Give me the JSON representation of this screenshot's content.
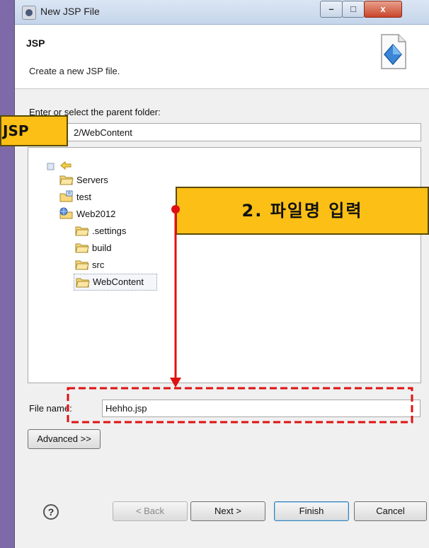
{
  "window": {
    "title": "New JSP File",
    "controls": {
      "minimize": "–",
      "maximize": "□",
      "close": "x"
    }
  },
  "header": {
    "title": "JSP",
    "description": "Create a new JSP file."
  },
  "folder": {
    "label": "Enter or select the parent folder:",
    "value": "2/WebContent"
  },
  "tree": {
    "items": [
      {
        "label": "Servers",
        "icon": "folder-icon"
      },
      {
        "label": "test",
        "icon": "project-icon"
      },
      {
        "label": "Web2012",
        "icon": "web-project-icon"
      },
      {
        "label": ".settings",
        "icon": "folder-icon"
      },
      {
        "label": "build",
        "icon": "folder-icon"
      },
      {
        "label": "src",
        "icon": "folder-icon"
      },
      {
        "label": "WebContent",
        "icon": "folder-icon",
        "selected": true
      }
    ]
  },
  "filename": {
    "label": "File name:",
    "value": "Hehho.jsp"
  },
  "buttons": {
    "advanced": "Advanced >>",
    "back": "< Back",
    "next": "Next >",
    "finish": "Finish",
    "cancel": "Cancel",
    "help": "?"
  },
  "annotations": {
    "callout_left": "JSP",
    "callout_right": "2. 파일명 입력",
    "accent_color": "#e01010",
    "callout_color": "#fbbf16"
  }
}
